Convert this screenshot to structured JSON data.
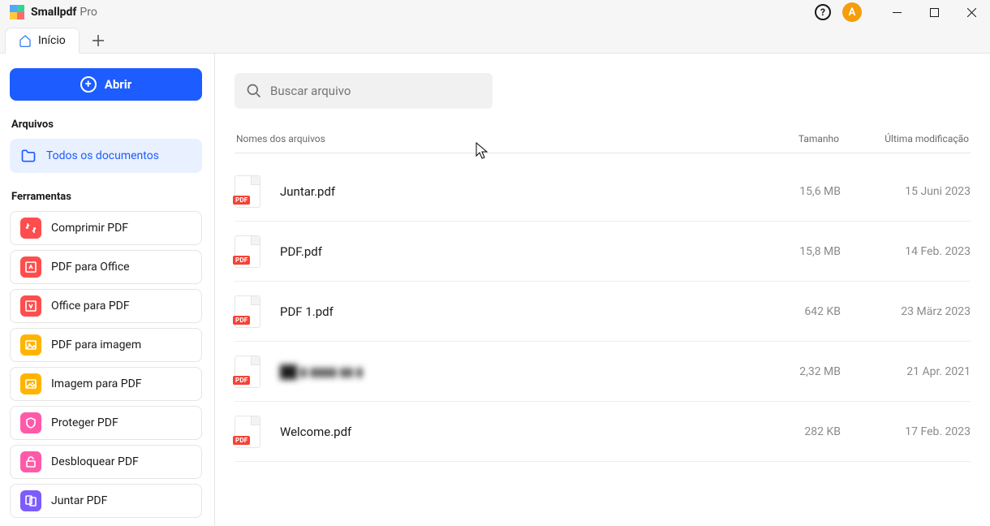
{
  "app": {
    "name": "Smallpdf",
    "edition": "Pro"
  },
  "avatar_initial": "A",
  "tab": {
    "label": "Início"
  },
  "open_button": "Abrir",
  "sections": {
    "files": "Arquivos",
    "tools": "Ferramentas"
  },
  "nav": {
    "all_docs": "Todos os documentos"
  },
  "tools": [
    {
      "label": "Comprimir PDF",
      "color": "#ff4d4d",
      "icon": "compress"
    },
    {
      "label": "PDF para Office",
      "color": "#ff4d4d",
      "icon": "to-office"
    },
    {
      "label": "Office para PDF",
      "color": "#ff4d4d",
      "icon": "from-office"
    },
    {
      "label": "PDF para imagem",
      "color": "#ffb400",
      "icon": "to-image"
    },
    {
      "label": "Imagem para PDF",
      "color": "#ffb400",
      "icon": "from-image"
    },
    {
      "label": "Proteger PDF",
      "color": "#ff5aa9",
      "icon": "shield"
    },
    {
      "label": "Desbloquear PDF",
      "color": "#ff5aa9",
      "icon": "unlock"
    },
    {
      "label": "Juntar PDF",
      "color": "#7c5cff",
      "icon": "merge"
    }
  ],
  "search": {
    "placeholder": "Buscar arquivo"
  },
  "columns": {
    "name": "Nomes dos arquivos",
    "size": "Tamanho",
    "date": "Última modificação"
  },
  "files": [
    {
      "name": "Juntar.pdf",
      "size": "15,6 MB",
      "date": "15 Juni 2023"
    },
    {
      "name": "PDF.pdf",
      "size": "15,8 MB",
      "date": "14 Feb. 2023"
    },
    {
      "name": "PDF 1.pdf",
      "size": "642 KB",
      "date": "23 März 2023"
    },
    {
      "name": "██ ▮ ▮▮▮▮ ▮▮ ▮",
      "size": "2,32 MB",
      "date": "21 Apr. 2021",
      "redacted": true
    },
    {
      "name": "Welcome.pdf",
      "size": "282 KB",
      "date": "17 Feb. 2023"
    }
  ],
  "pdf_badge": "PDF"
}
